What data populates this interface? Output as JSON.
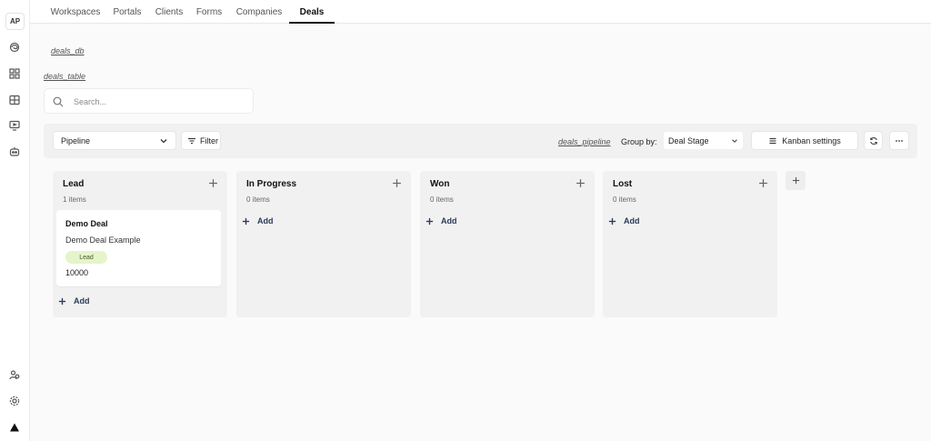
{
  "user": {
    "initials": "AP"
  },
  "rail": {
    "top_icons": [
      "spiral-icon",
      "grid-icon",
      "table-icon",
      "monitor-icon",
      "bot-icon"
    ],
    "bottom_icons": [
      "users-icon",
      "settings-icon",
      "logo-icon"
    ]
  },
  "tabs": [
    {
      "label": "Workspaces",
      "active": false
    },
    {
      "label": "Portals",
      "active": false
    },
    {
      "label": "Clients",
      "active": false
    },
    {
      "label": "Forms",
      "active": false
    },
    {
      "label": "Companies",
      "active": false
    },
    {
      "label": "Deals",
      "active": true
    }
  ],
  "database_label": "deals_db",
  "table_label": "deals_table",
  "search": {
    "placeholder": "Search...",
    "value": ""
  },
  "toolbar": {
    "view_select": "Pipeline",
    "filter_label": "Filter",
    "pipeline_label": "deals_pipeline",
    "group_by_label": "Group by:",
    "group_by_value": "Deal Stage",
    "kanban_settings_label": "Kanban settings"
  },
  "board": {
    "add_label": "Add",
    "columns": [
      {
        "title": "Lead",
        "count": "1 items",
        "cards": [
          {
            "title": "Demo Deal",
            "subtitle": "Demo Deal Example",
            "badge": "Lead",
            "value": "10000"
          }
        ]
      },
      {
        "title": "In Progress",
        "count": "0 items",
        "cards": []
      },
      {
        "title": "Won",
        "count": "0 items",
        "cards": []
      },
      {
        "title": "Lost",
        "count": "0 items",
        "cards": []
      }
    ]
  },
  "colors": {
    "badge_bg": "#e6f4c9",
    "add_text": "#2b3a55",
    "active_tab": "#111111"
  }
}
